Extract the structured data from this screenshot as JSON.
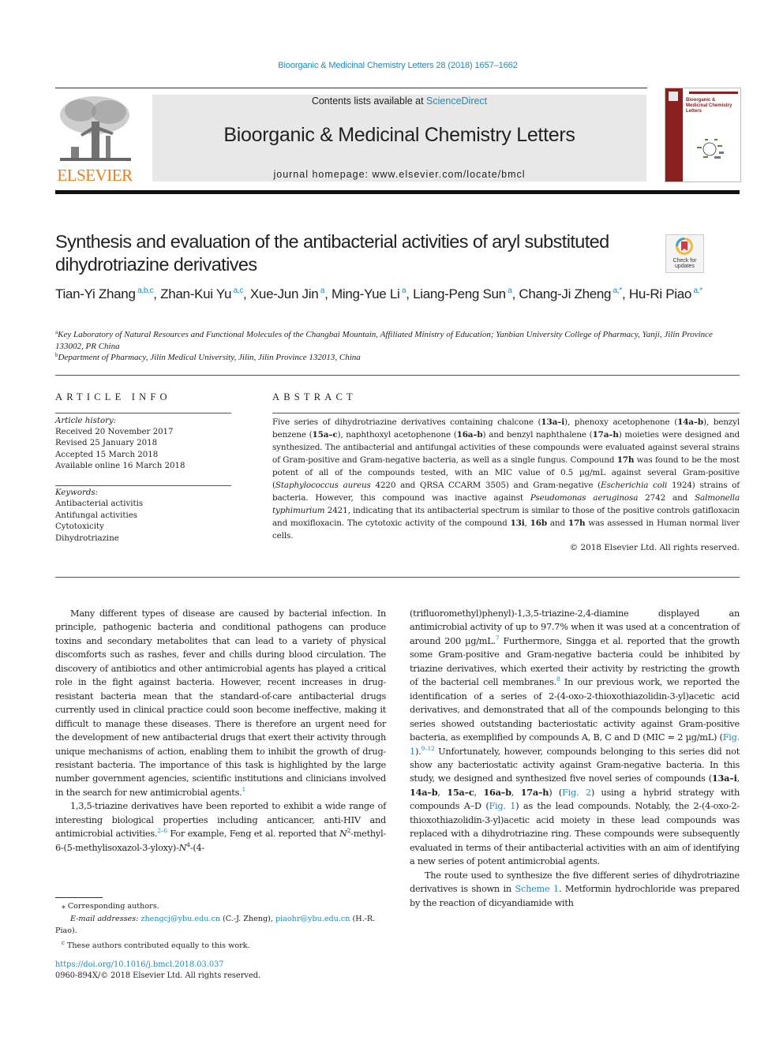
{
  "colors": {
    "link": "#1f8ab8",
    "publisher_orange": "#e87d1e",
    "masthead_bg": "#e8e8e8",
    "cover_red": "#8a1f1f"
  },
  "header": {
    "citation": "Bioorganic & Medicinal Chemistry Letters 28 (2018) 1657–1662",
    "contents_prefix": "Contents lists available at ",
    "contents_link": "ScienceDirect",
    "journal_title": "Bioorganic & Medicinal Chemistry Letters",
    "homepage_prefix": "journal homepage: ",
    "homepage_url": "www.elsevier.com/locate/bmcl",
    "publisher_logo_text": "ELSEVIER",
    "cover_title": "Bioorganic & Medicinal Chemistry Letters"
  },
  "article": {
    "title": "Synthesis and evaluation of the antibacterial activities of aryl substituted dihydrotriazine derivatives",
    "crossmark_label": "Check for updates",
    "authors": [
      {
        "name": "Tian-Yi Zhang",
        "sup": "a,b,c",
        "sep": ", "
      },
      {
        "name": "Zhan-Kui Yu",
        "sup": "a,c",
        "sep": ", "
      },
      {
        "name": "Xue-Jun Jin",
        "sup": "a",
        "sep": ", "
      },
      {
        "name": "Ming-Yue Li",
        "sup": "a",
        "sep": ", "
      },
      {
        "name": "Liang-Peng Sun",
        "sup": "a",
        "sep": ", "
      },
      {
        "name": "Chang-Ji Zheng",
        "sup": "a,*",
        "sep": ","
      },
      {
        "name": "Hu-Ri Piao",
        "sup": "a,*",
        "sep": ""
      }
    ],
    "affiliations": [
      {
        "key": "a",
        "text": "Key Laboratory of Natural Resources and Functional Molecules of the Changbai Mountain, Affiliated Ministry of Education; Yanbian University College of Pharmacy, Yanji, Jilin Province 133002, PR China"
      },
      {
        "key": "b",
        "text": "Department of Pharmacy, Jilin Medical University, Jilin, Jilin Province 132013, China"
      }
    ]
  },
  "article_info": {
    "heading": "ARTICLE INFO",
    "history_label": "Article history:",
    "history": [
      "Received 20 November 2017",
      "Revised 25 January 2018",
      "Accepted 15 March 2018",
      "Available online 16 March 2018"
    ],
    "keywords_label": "Keywords:",
    "keywords": [
      "Antibacterial activitis",
      "Antifungal activities",
      "Cytotoxicity",
      "Dihydrotriazine"
    ]
  },
  "abstract": {
    "heading": "ABSTRACT",
    "segments": [
      {
        "t": "Five series of dihydrotriazine derivatives containing chalcone ("
      },
      {
        "t": "13a–i",
        "b": true
      },
      {
        "t": "), phenoxy acetophenone ("
      },
      {
        "t": "14a–b",
        "b": true
      },
      {
        "t": "), benzyl benzene ("
      },
      {
        "t": "15a–c",
        "b": true
      },
      {
        "t": "), naphthoxyl acetophenone ("
      },
      {
        "t": "16a–b",
        "b": true
      },
      {
        "t": ") and benzyl naphthalene ("
      },
      {
        "t": "17a–h",
        "b": true
      },
      {
        "t": ") moieties were designed and synthesized. The antibacterial and antifungal activities of these compounds were evaluated against several strains of Gram-positive and Gram-negative bacteria, as well as a single fungus. Compound "
      },
      {
        "t": "17h",
        "b": true
      },
      {
        "t": " was found to be the most potent of all of the compounds tested, with an MIC value of 0.5 µg/mL against several Gram-positive ("
      },
      {
        "t": "Staphylococcus aureus",
        "i": true
      },
      {
        "t": " 4220 and QRSA CCARM 3505) and Gram-negative ("
      },
      {
        "t": "Escherichia coli",
        "i": true
      },
      {
        "t": " 1924) strains of bacteria. However, this compound was inactive against "
      },
      {
        "t": "Pseudomonas aeruginosa",
        "i": true
      },
      {
        "t": " 2742 and "
      },
      {
        "t": "Salmonella typhimurium",
        "i": true
      },
      {
        "t": " 2421, indicating that its antibacterial spectrum is similar to those of the positive controls gatifloxacin and moxifloxacin. The cytotoxic activity of the compound "
      },
      {
        "t": "13i",
        "b": true
      },
      {
        "t": ", "
      },
      {
        "t": "16b",
        "b": true
      },
      {
        "t": " and "
      },
      {
        "t": "17h",
        "b": true
      },
      {
        "t": " was assessed in Human normal liver cells."
      }
    ],
    "copyright": "© 2018 Elsevier Ltd. All rights reserved."
  },
  "body": {
    "left": [
      {
        "segments": [
          {
            "t": "Many different types of disease are caused by bacterial infection. In principle, pathogenic bacteria and conditional pathogens can produce toxins and secondary metabolites that can lead to a variety of physical discomforts such as rashes, fever and chills during blood circulation. The discovery of antibiotics and other antimicrobial agents has played a critical role in the fight against bacteria. However, recent increases in drug-resistant bacteria mean that the standard-of-care antibacterial drugs currently used in clinical practice could soon become ineffective, making it difficult to manage these diseases. There is therefore an urgent need for the development of new antibacterial drugs that exert their activity through unique mechanisms of action, enabling them to inhibit the growth of drug-resistant bacteria. The importance of this task is highlighted by the large number government agencies, scientific institutions and clinicians involved in the search for new antimicrobial agents."
          },
          {
            "t": "1",
            "ref": true
          }
        ]
      },
      {
        "segments": [
          {
            "t": "1,3,5-triazine derivatives have been reported to exhibit a wide range of interesting biological properties including anticancer, anti-HIV and antimicrobial activities."
          },
          {
            "t": "2–6",
            "ref": true
          },
          {
            "t": " For example, Feng et al. reported that "
          },
          {
            "t": "N",
            "i": true
          },
          {
            "t": "2",
            "sup": true
          },
          {
            "t": "-methyl-6-(5-methylisoxazol-3-yloxy)-"
          },
          {
            "t": "N",
            "i": true
          },
          {
            "t": "4",
            "sup": true
          },
          {
            "t": "-(4-"
          }
        ]
      }
    ],
    "right": [
      {
        "noindent": true,
        "segments": [
          {
            "t": "(trifluoromethyl)phenyl)-1,3,5-triazine-2,4-diamine displayed an antimicrobial activity of up to 97.7% when it was used at a concentration of around 200 µg/mL."
          },
          {
            "t": "7",
            "ref": true
          },
          {
            "t": " Furthermore, Singga et al. reported that the growth some Gram-positive and Gram-negative bacteria could be inhibited by triazine derivatives, which exerted their activity by restricting the growth of the bacterial cell membranes."
          },
          {
            "t": "8",
            "ref": true
          },
          {
            "t": " In our previous work, we reported the identification of a series of 2-(4-oxo-2-thioxothiazolidin-3-yl)acetic acid derivatives, and demonstrated that all of the compounds belonging to this series showed outstanding bacteriostatic activity against Gram-positive bacteria, as exemplified by compounds A, B, C and D (MIC = 2 µg/mL) ("
          },
          {
            "t": "Fig. 1",
            "link": true
          },
          {
            "t": ")."
          },
          {
            "t": "9–12",
            "ref": true
          },
          {
            "t": " Unfortunately, however, compounds belonging to this series did not show any bacteriostatic activity against Gram-negative bacteria. In this study, we designed and synthesized five novel series of compounds ("
          },
          {
            "t": "13a–i",
            "b": true
          },
          {
            "t": ", "
          },
          {
            "t": "14a–b",
            "b": true
          },
          {
            "t": ", "
          },
          {
            "t": "15a–c",
            "b": true
          },
          {
            "t": ", "
          },
          {
            "t": "16a–b",
            "b": true
          },
          {
            "t": ", "
          },
          {
            "t": "17a–h",
            "b": true
          },
          {
            "t": ") ("
          },
          {
            "t": "Fig. 2",
            "link": true
          },
          {
            "t": ") using a hybrid strategy with compounds A–D ("
          },
          {
            "t": "Fig. 1",
            "link": true
          },
          {
            "t": ") as the lead compounds. Notably, the 2-(4-oxo-2-thioxothiazolidin-3-yl)acetic acid moiety in these lead compounds was replaced with a dihydrotriazine ring. These compounds were subsequently evaluated in terms of their antibacterial activities with an aim of identifying a new series of potent antimicrobial agents."
          }
        ]
      },
      {
        "segments": [
          {
            "t": "The route used to synthesize the five different series of dihydrotriazine derivatives is shown in "
          },
          {
            "t": "Scheme 1",
            "link": true
          },
          {
            "t": ". Metformin hydrochloride was prepared by the reaction of dicyandiamide with"
          }
        ]
      }
    ]
  },
  "footnotes": {
    "corresponding": "⁎ Corresponding authors.",
    "email_label": "E-mail addresses:",
    "emails": [
      {
        "address": "zhengcj@ybu.edu.cn",
        "who": " (C.-J. Zheng), "
      },
      {
        "address": "piaohr@ybu.edu.cn",
        "who": " (H.-R. Piao)."
      }
    ],
    "equal_contribution_key": "c",
    "equal_contribution": " These authors contributed equally to this work.",
    "doi": "https://doi.org/10.1016/j.bmcl.2018.03.037",
    "issn": "0960-894X/© 2018 Elsevier Ltd. All rights reserved."
  }
}
